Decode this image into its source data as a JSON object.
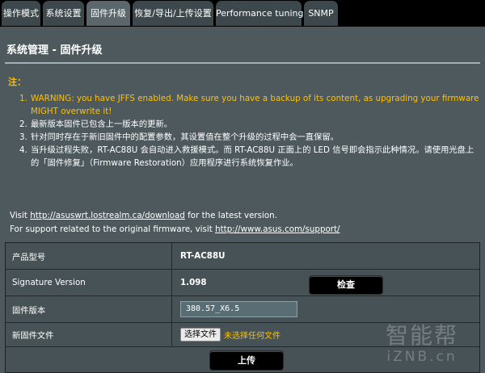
{
  "tabs": [
    {
      "label": "操作模式",
      "active": false
    },
    {
      "label": "系统设置",
      "active": false
    },
    {
      "label": "固件升级",
      "active": true
    },
    {
      "label": "恢复/导出/上传设置",
      "active": false
    },
    {
      "label": "Performance tuning",
      "active": false
    },
    {
      "label": "SNMP",
      "active": false
    }
  ],
  "page_title": "系统管理 - 固件升级",
  "notes_label": "注：",
  "notes": [
    {
      "num": "1.",
      "text": "WARNING: you have JFFS enabled. Make sure you have a backup of its content, as upgrading your firmware MIGHT overwrite it!"
    },
    {
      "num": "2.",
      "text": "最新版本固件已包含上一版本的更新。"
    },
    {
      "num": "3.",
      "text": "针对同时存在于新旧固件中的配置参数，其设置值在整个升级的过程中会一直保留。"
    },
    {
      "num": "4.",
      "text": "当升级过程失败，RT-AC88U 会自动进入救援模式。而 RT-AC88U 正面上的 LED 信号即会指示此种情况。请使用光盘上的「固件修复」（Firmware Restoration）应用程序进行系统恢复作业。"
    }
  ],
  "visit": {
    "prefix": "Visit ",
    "link": "http://asuswrt.lostrealm.ca/download",
    "suffix": " for the latest version."
  },
  "support": {
    "prefix": "For support related to the original firmware, visit ",
    "link": "http://www.asus.com/support/"
  },
  "form": {
    "model_label": "产品型号",
    "model_value": "RT-AC88U",
    "signature_label": "Signature Version",
    "signature_value": "1.098",
    "check_button": "检查",
    "fw_label": "固件版本",
    "fw_value": "380.57_X6.5",
    "newfw_label": "新固件文件",
    "choose_file_button": "选择文件",
    "no_file_text": "未选择任何文件",
    "upload_button": "上传"
  },
  "watermark": {
    "line1": "智能帮",
    "line2": "iZNB.cn"
  },
  "colors": {
    "background": "#4d595d",
    "tab_inactive": "#3d484c",
    "tab_active": "#5b676b",
    "warning_accent": "#ffc000",
    "button": "#000000"
  }
}
